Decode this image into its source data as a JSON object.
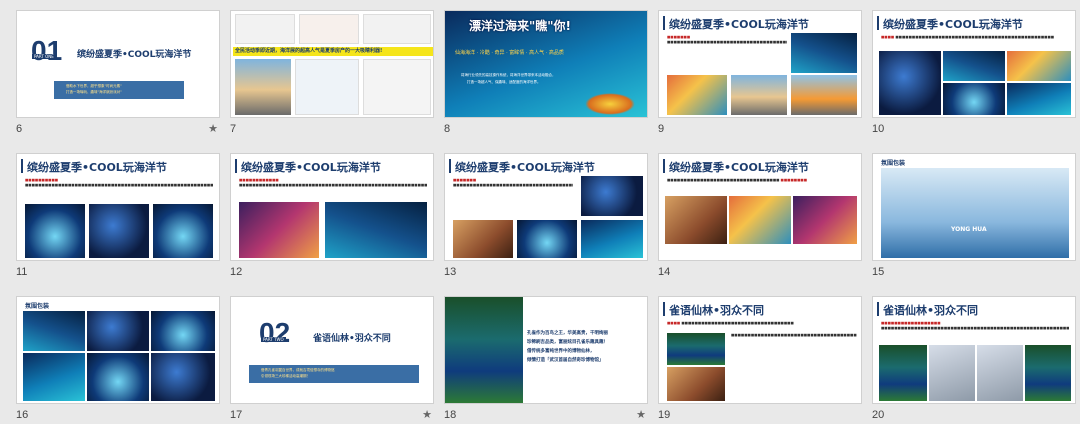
{
  "slides": [
    {
      "num": "6",
      "starred": true,
      "part_number": "01",
      "part_label": "PART ONE",
      "title": "缤纷盛夏季•COOL玩海洋节",
      "subtitle_lines": [
        "借助水下世界，超乎想象\"时尚元素\"",
        "打造一场嗨玩、趣味\"海洋缤纷派对\""
      ]
    },
    {
      "num": "7",
      "starred": false,
      "headline": "全民活动季即近期，海洋展的超高人气是夏季房产的一大吸睛利器!"
    },
    {
      "num": "8",
      "starred": false,
      "title": "漂洋过海来\"瞧\"你!",
      "tags": "仙海海洋 · 冷酷 · 奇异 · 富眸情 · 高人气 · 高品质",
      "body_lines": [
        "将海行业领先的高技操作系统，将海洋世界带来本活动融合，",
        "打造一场超人气、保趣味、适配度的海洋世界。"
      ]
    },
    {
      "num": "9",
      "starred": false,
      "title": "缤纷盛夏季•COOL玩海洋节"
    },
    {
      "num": "10",
      "starred": false,
      "title": "缤纷盛夏季•COOL玩海洋节"
    },
    {
      "num": "11",
      "starred": false,
      "title": "缤纷盛夏季•COOL玩海洋节"
    },
    {
      "num": "12",
      "starred": false,
      "title": "缤纷盛夏季•COOL玩海洋节"
    },
    {
      "num": "13",
      "starred": false,
      "title": "缤纷盛夏季•COOL玩海洋节"
    },
    {
      "num": "14",
      "starred": false,
      "title": "缤纷盛夏季•COOL玩海洋节"
    },
    {
      "num": "15",
      "starred": false,
      "title": "氛围包装",
      "banner": "YONG HUA"
    },
    {
      "num": "16",
      "starred": false,
      "title": "氛围包装"
    },
    {
      "num": "17",
      "starred": true,
      "part_number": "02",
      "part_label": "PART TWO",
      "title": "雀语仙林•羽众不同",
      "subtitle_lines": [
        "借青孔雀羽翼百世界，成就吉境倍想寺的博物馆",
        "引领现场三大珍稀活动高潮期！"
      ]
    },
    {
      "num": "18",
      "starred": true,
      "body_lines": [
        "孔雀作为百鸟之王，华美高贵，干明绚丽",
        "珍稀刷吉品类，富丽炫目孔雀乐趣具趣！",
        "借传统多富纯世界中的博物仙林，",
        "倾情打造「武汉首届自然奇珍博物馆」"
      ]
    },
    {
      "num": "19",
      "starred": false,
      "title": "雀语仙林•羽众不同"
    },
    {
      "num": "20",
      "starred": false,
      "title": "雀语仙林•羽众不同"
    }
  ],
  "colors": {
    "brand_blue": "#1d3d6e",
    "accent_red": "#c62828",
    "subtitle_bar": "#3a6ea5"
  }
}
